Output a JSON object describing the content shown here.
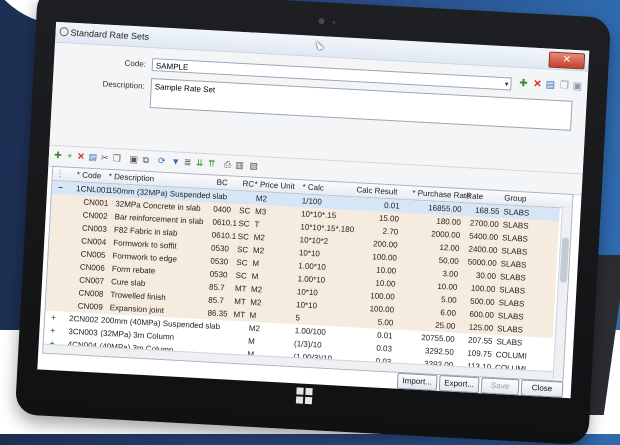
{
  "window": {
    "title": "Standard Rate Sets",
    "close_glyph": "✕"
  },
  "form": {
    "code_label": "Code:",
    "code_value": "SAMPLE",
    "dropdown_glyph": "▾",
    "description_label": "Description:",
    "description_value": "Sample Rate Set"
  },
  "columns": {
    "code": "* Code",
    "description": "* Description",
    "bc": "BC",
    "rc": "RC",
    "price_unit": "* Price Unit",
    "calc": "* Calc",
    "calc_result": "Calc Result",
    "purchase_rate": "* Purchase Rate",
    "rate": "Rate",
    "group": "Group"
  },
  "rows": [
    {
      "expander": "−",
      "code": "1CNL001",
      "desc": "150mm (32MPa) Suspended slab",
      "bc": "",
      "rc": "",
      "unit": "M2",
      "calc": "1/100",
      "result": "0.01",
      "purchase": "16855.00",
      "rate": "168.55",
      "group": "SLABS"
    },
    {
      "expander": "",
      "code": "CN001",
      "desc": "32MPa Concrete in slab",
      "bc": "0400",
      "rc": "SC",
      "unit": "M3",
      "calc": "10*10*.15",
      "result": "15.00",
      "purchase": "180.00",
      "rate": "2700.00",
      "group": "SLABS"
    },
    {
      "expander": "",
      "code": "CN002",
      "desc": "Bar reinforcement in slab",
      "bc": "0610.1",
      "rc": "SC",
      "unit": "T",
      "calc": "10*10*.15*.180",
      "result": "2.70",
      "purchase": "2000.00",
      "rate": "5400.00",
      "group": "SLABS"
    },
    {
      "expander": "",
      "code": "CN003",
      "desc": "F82 Fabric in slab",
      "bc": "0610.1",
      "rc": "SC",
      "unit": "M2",
      "calc": "10*10*2",
      "result": "200.00",
      "purchase": "12.00",
      "rate": "2400.00",
      "group": "SLABS"
    },
    {
      "expander": "",
      "code": "CN004",
      "desc": "Formwork to soffit",
      "bc": "0530",
      "rc": "SC",
      "unit": "M2",
      "calc": "10*10",
      "result": "100.00",
      "purchase": "50.00",
      "rate": "5000.00",
      "group": "SLABS"
    },
    {
      "expander": "",
      "code": "CN005",
      "desc": "Formwork to edge",
      "bc": "0530",
      "rc": "SC",
      "unit": "M",
      "calc": "1.00*10",
      "result": "10.00",
      "purchase": "3.00",
      "rate": "30.00",
      "group": "SLABS"
    },
    {
      "expander": "",
      "code": "CN006",
      "desc": "Form rebate",
      "bc": "0530",
      "rc": "SC",
      "unit": "M",
      "calc": "1.00*10",
      "result": "10.00",
      "purchase": "10.00",
      "rate": "100.00",
      "group": "SLABS"
    },
    {
      "expander": "",
      "code": "CN007",
      "desc": "Cure slab",
      "bc": "85.7",
      "rc": "MT",
      "unit": "M2",
      "calc": "10*10",
      "result": "100.00",
      "purchase": "5.00",
      "rate": "500.00",
      "group": "SLABS"
    },
    {
      "expander": "",
      "code": "CN008",
      "desc": "Trowelled finish",
      "bc": "85.7",
      "rc": "MT",
      "unit": "M2",
      "calc": "10*10",
      "result": "100.00",
      "purchase": "6.00",
      "rate": "600.00",
      "group": "SLABS"
    },
    {
      "expander": "",
      "code": "CN009",
      "desc": "Expansion joint",
      "bc": "86.35",
      "rc": "MT",
      "unit": "M",
      "calc": "5",
      "result": "5.00",
      "purchase": "25.00",
      "rate": "125.00",
      "group": "SLABS"
    },
    {
      "expander": "+",
      "code": "2CN002",
      "desc": "200mm (40MPa) Suspended slab",
      "bc": "",
      "rc": "",
      "unit": "M2",
      "calc": "1.00/100",
      "result": "0.01",
      "purchase": "20755.00",
      "rate": "207.55",
      "group": "SLABS"
    },
    {
      "expander": "+",
      "code": "3CN003",
      "desc": "(32MPa) 3m Column",
      "bc": "",
      "rc": "",
      "unit": "M",
      "calc": "(1/3)/10",
      "result": "0.03",
      "purchase": "3292.50",
      "rate": "109.75",
      "group": "COLUMI"
    },
    {
      "expander": "+",
      "code": "4CN004",
      "desc": "(40MPa) 3m Column",
      "bc": "",
      "rc": "",
      "unit": "M",
      "calc": "(1.00/3)/10",
      "result": "0.03",
      "purchase": "3393.00",
      "rate": "113.10",
      "group": "COLUMI"
    }
  ],
  "buttons": {
    "import": "Import...",
    "export": "Export...",
    "save": "Save",
    "close": "Close"
  }
}
